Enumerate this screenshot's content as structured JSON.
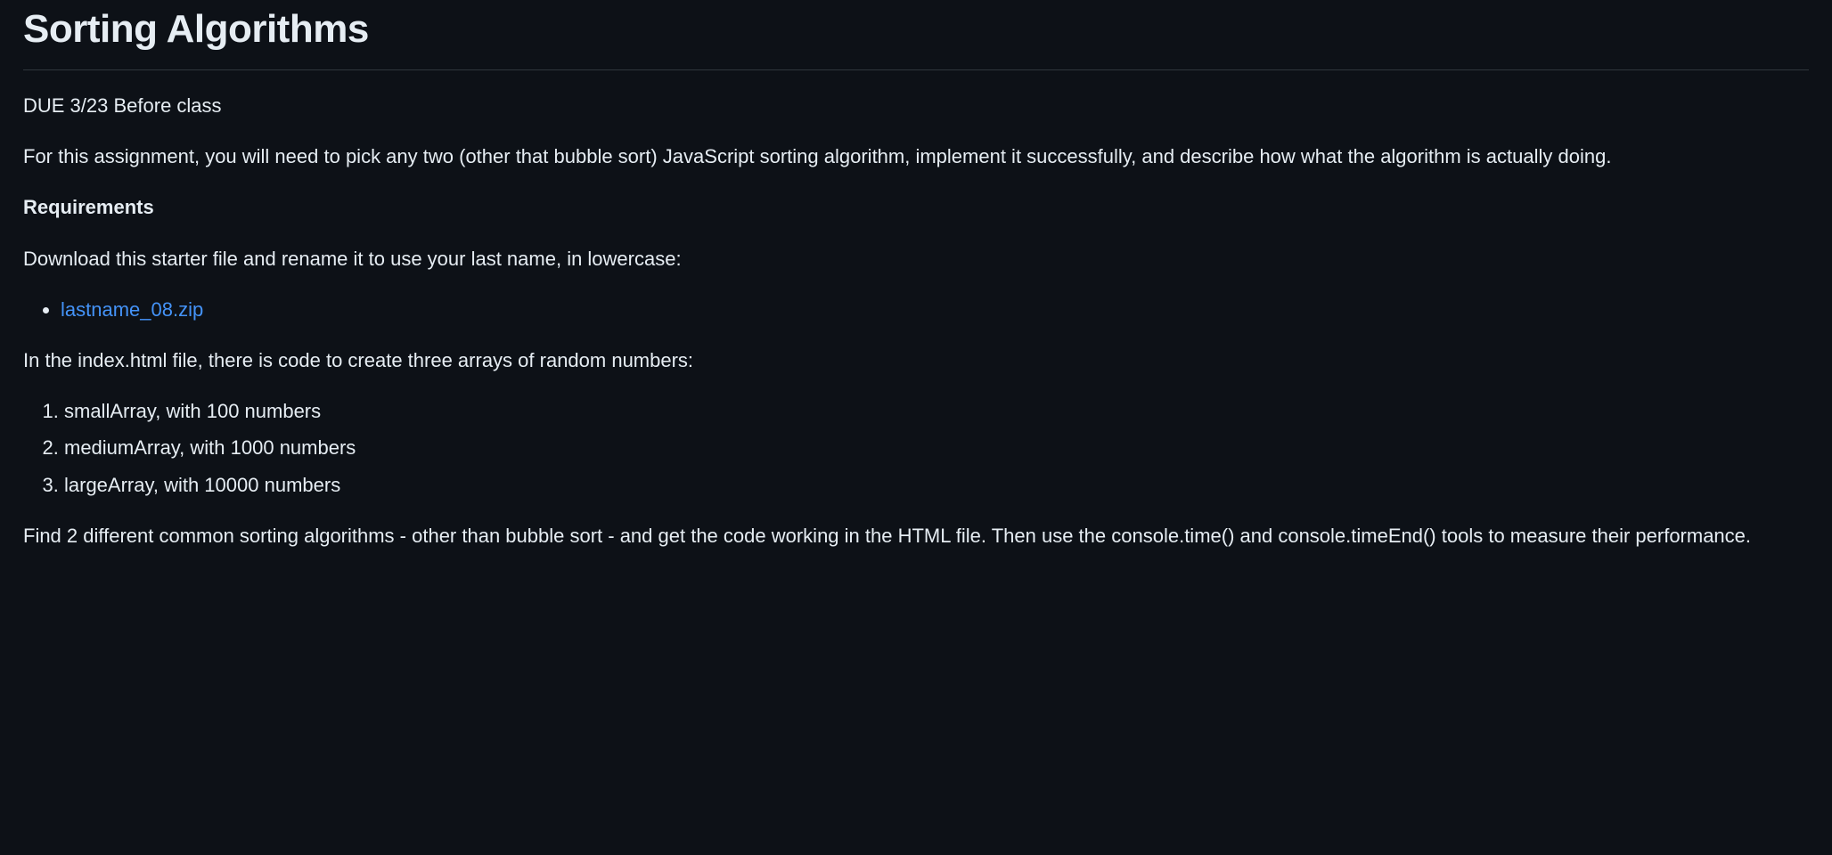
{
  "heading": "Sorting Algorithms",
  "due_line": "DUE 3/23 Before class",
  "intro_para": "For this assignment, you will need to pick any two (other that bubble sort) JavaScript sorting algorithm, implement it successfully, and describe how what the algorithm is actually doing.",
  "requirements_label": "Requirements",
  "download_para": "Download this starter file and rename it to use your last name, in lowercase:",
  "starter_link_text": "lastname_08.zip",
  "index_para": "In the index.html file, there is code to create three arrays of random numbers:",
  "arrays": [
    "smallArray, with 100 numbers",
    "mediumArray, with 1000 numbers",
    "largeArray, with 10000 numbers"
  ],
  "find_para": "Find 2 different common sorting algorithms - other than bubble sort - and get the code working in the HTML file. Then use the console.time() and console.timeEnd() tools to measure their performance."
}
